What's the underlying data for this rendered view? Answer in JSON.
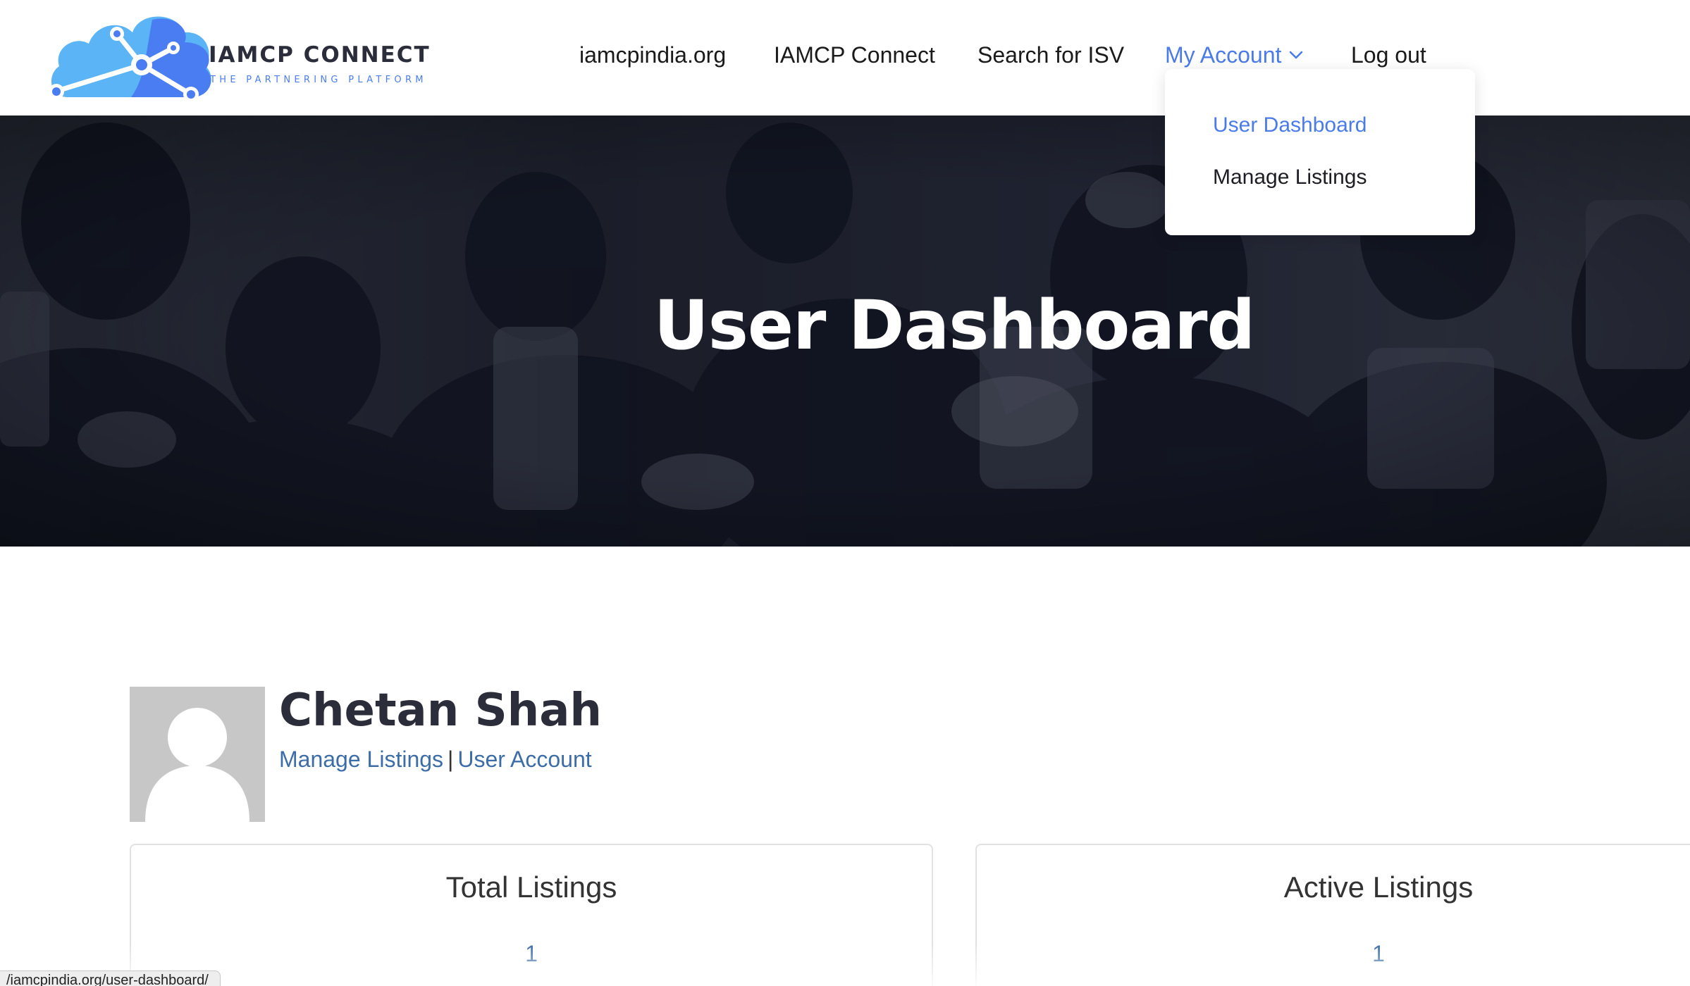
{
  "brand": {
    "title": "IAMCP CONNECT",
    "subtitle": "THE PARTNERING PLATFORM",
    "colors": {
      "light_blue": "#5ab4f5",
      "blue": "#4a7be8",
      "dark": "#2b2d3a"
    }
  },
  "nav": {
    "items": [
      {
        "label": "iamcpindia.org"
      },
      {
        "label": "IAMCP Connect"
      },
      {
        "label": "Search for ISV"
      },
      {
        "label": "My Account",
        "active": true,
        "icon": "chevron-down-icon"
      },
      {
        "label": "Log out"
      }
    ],
    "dropdown": {
      "items": [
        {
          "label": "User Dashboard",
          "current": true
        },
        {
          "label": "Manage Listings"
        }
      ]
    }
  },
  "hero": {
    "title": "User Dashboard"
  },
  "profile": {
    "name": "Chetan Shah",
    "avatar_icon": "default-avatar-icon",
    "links": {
      "manage": "Manage Listings",
      "separator": "|",
      "account": "User Account"
    }
  },
  "stats": [
    {
      "label": "Total Listings",
      "value": "1"
    },
    {
      "label": "Active Listings",
      "value": "1"
    }
  ],
  "status_url": "/iamcpindia.org/user-dashboard/"
}
